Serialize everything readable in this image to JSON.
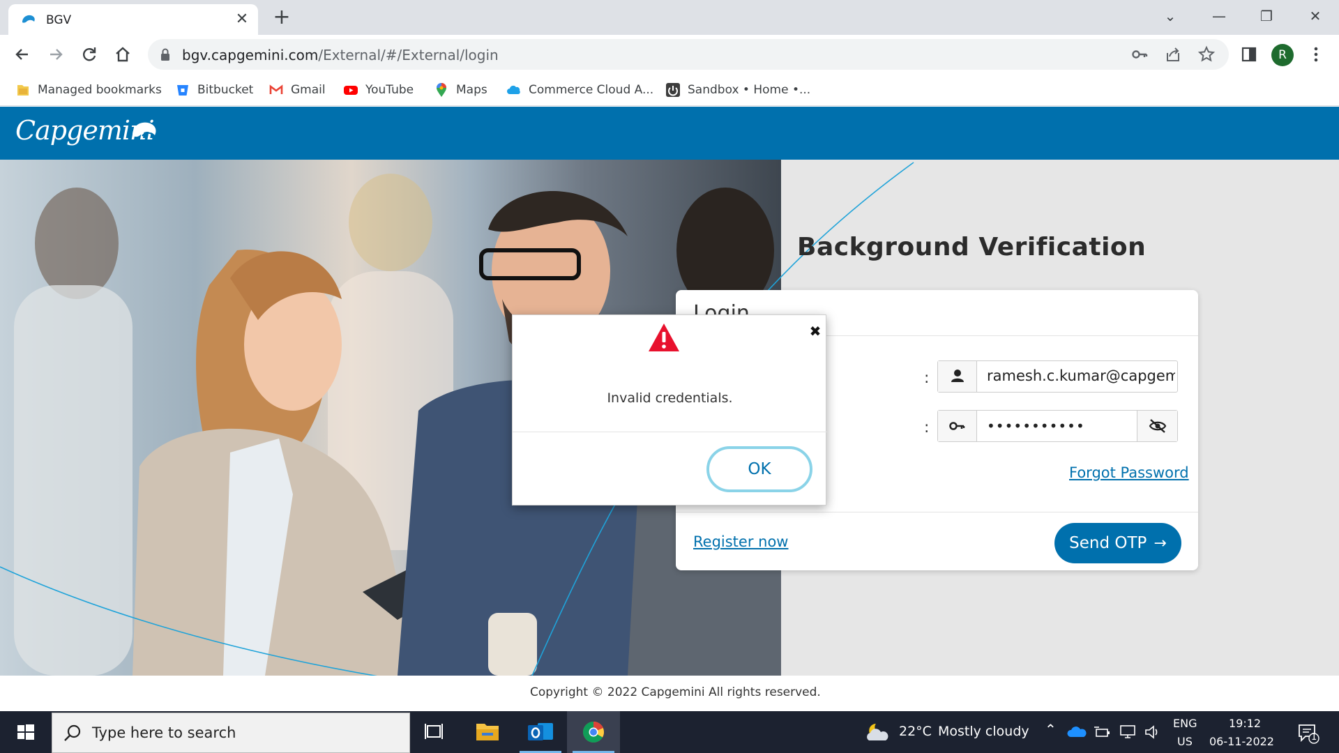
{
  "browser": {
    "tab_title": "BGV",
    "url_host": "bgv.capgemini.com",
    "url_path": "/External/#/External/login",
    "profile_initial": "R",
    "bookmarks": [
      {
        "label": "Managed bookmarks",
        "icon": "folder-icon"
      },
      {
        "label": "Bitbucket",
        "icon": "bitbucket-icon"
      },
      {
        "label": "Gmail",
        "icon": "gmail-icon"
      },
      {
        "label": "YouTube",
        "icon": "youtube-icon"
      },
      {
        "label": "Maps",
        "icon": "maps-icon"
      },
      {
        "label": "Commerce Cloud A...",
        "icon": "cloud-icon"
      },
      {
        "label": "Sandbox • Home •...",
        "icon": "sandbox-icon"
      }
    ]
  },
  "page": {
    "brand": "Capgemini",
    "heading": "Background Verification",
    "login": {
      "title": "Login",
      "username_value": "ramesh.c.kumar@capgemini.com",
      "password_masked": "•••••••••••",
      "forgot_label": "Forgot Password",
      "register_label": "Register now",
      "send_otp_label": "Send OTP"
    },
    "copyright": "Copyright © 2022 Capgemini All rights reserved."
  },
  "modal": {
    "message": "Invalid credentials.",
    "ok_label": "OK"
  },
  "taskbar": {
    "search_placeholder": "Type here to search",
    "temperature": "22°C",
    "weather": "Mostly cloudy",
    "lang_top": "ENG",
    "lang_bottom": "US",
    "time": "19:12",
    "date": "06-11-2022",
    "notification_count": "1"
  },
  "colors": {
    "brand_blue": "#0070ad",
    "ok_ring": "#8ad3e8",
    "warning_red": "#e8112d"
  }
}
